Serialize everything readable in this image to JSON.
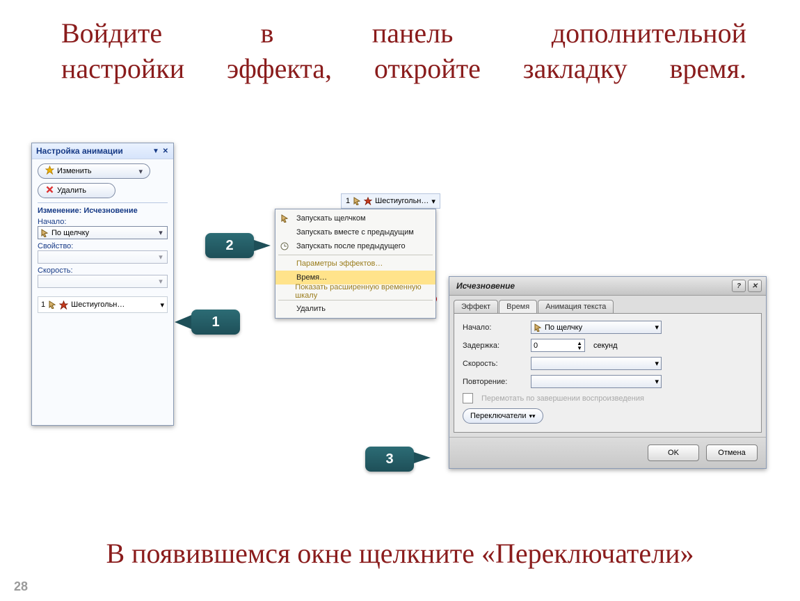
{
  "slide": {
    "title_line1": "Войдите в панель дополнительной",
    "title_line2": "настройки эффекта, откройте закладку время.",
    "bottom": "В появившемся окне щелкните «Переключатели»",
    "page": "28"
  },
  "callouts": {
    "c1": "1",
    "c2": "2",
    "c3": "3"
  },
  "taskpane": {
    "title": "Настройка анимации",
    "change_btn": "Изменить",
    "delete_btn": "Удалить",
    "section": "Изменение: Исчезновение",
    "start_lbl": "Начало:",
    "start_val": "По щелчку",
    "prop_lbl": "Свойство:",
    "speed_lbl": "Скорость:",
    "item_num": "1",
    "item_text": "Шестиугольн…"
  },
  "ctx": {
    "item_tag_num": "1",
    "item_tag_text": "Шестиугольн…",
    "r1": "Запускать щелчком",
    "r2": "Запускать вместе с предыдущим",
    "r3": "Запускать после предыдущего",
    "r4": "Параметры эффектов…",
    "r5": "Время…",
    "r6": "Показать расширенную временную шкалу",
    "r7": "Удалить"
  },
  "dialog": {
    "title": "Исчезновение",
    "tab1": "Эффект",
    "tab2": "Время",
    "tab3": "Анимация текста",
    "start_lbl": "Начало:",
    "start_val": "По щелчку",
    "delay_lbl": "Задержка:",
    "delay_val": "0",
    "delay_unit": "секунд",
    "speed_lbl": "Скорость:",
    "repeat_lbl": "Повторение:",
    "rewind_lbl": "Перемотать по завершении воспроизведения",
    "triggers_btn": "Переключатели",
    "ok": "OK",
    "cancel": "Отмена"
  }
}
